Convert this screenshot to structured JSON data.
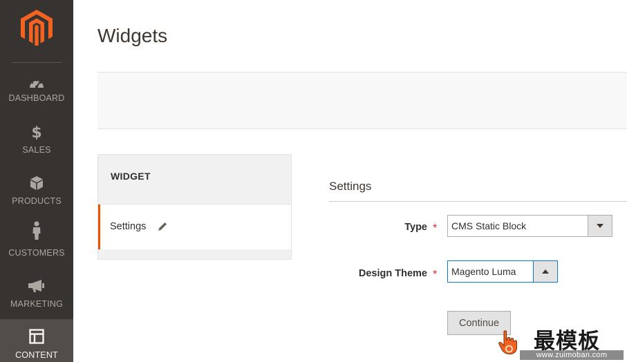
{
  "sidebar": {
    "items": [
      {
        "label": "DASHBOARD",
        "icon": "dashboard-icon"
      },
      {
        "label": "SALES",
        "icon": "dollar-icon"
      },
      {
        "label": "PRODUCTS",
        "icon": "box-icon"
      },
      {
        "label": "CUSTOMERS",
        "icon": "person-icon"
      },
      {
        "label": "MARKETING",
        "icon": "megaphone-icon"
      },
      {
        "label": "CONTENT",
        "icon": "layout-icon"
      }
    ],
    "active": "CONTENT"
  },
  "page": {
    "title": "Widgets"
  },
  "tabs": {
    "heading": "WIDGET",
    "items": [
      {
        "label": "Settings",
        "icon": "pencil-icon"
      }
    ]
  },
  "form": {
    "section_title": "Settings",
    "type_label": "Type",
    "type_value": "CMS Static Block",
    "theme_label": "Design Theme",
    "theme_value": "Magento Luma",
    "required_mark": "*",
    "continue_label": "Continue"
  },
  "watermark": {
    "main": "最模板",
    "sub": "www.zuimoban.com"
  },
  "colors": {
    "sidebar_bg": "#373330",
    "accent": "#eb5202",
    "required": "#e22626",
    "focus": "#007bdb"
  }
}
